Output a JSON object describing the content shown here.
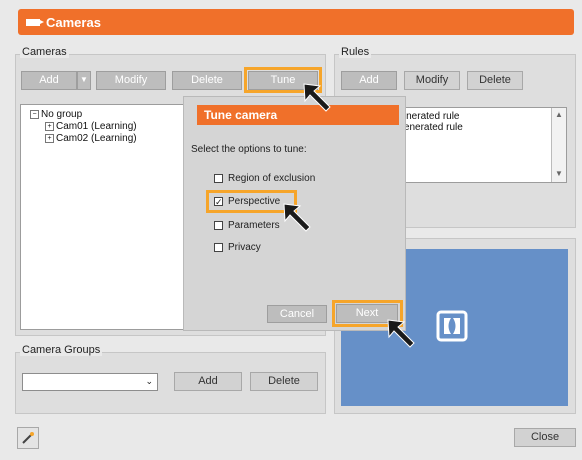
{
  "window": {
    "title": "Cameras"
  },
  "cameras": {
    "group_label": "Cameras",
    "add_label": "Add",
    "modify_label": "Modify",
    "delete_label": "Delete",
    "tune_label": "Tune",
    "tree": {
      "root": "No group",
      "items": [
        "Cam01 (Learning)",
        "Cam02 (Learning)"
      ]
    }
  },
  "rules": {
    "group_label": "Rules",
    "add_label": "Add",
    "modify_label": "Modify",
    "delete_label": "Delete",
    "items": [
      "generated rule",
      "-generated rule"
    ]
  },
  "camera_groups": {
    "group_label": "Camera Groups",
    "select_value": "",
    "add_label": "Add",
    "delete_label": "Delete"
  },
  "tune_dialog": {
    "title": "Tune camera",
    "instruction": "Select the options to tune:",
    "options": [
      {
        "label": "Region of exclusion",
        "checked": false
      },
      {
        "label": "Perspective",
        "checked": true
      },
      {
        "label": "Parameters",
        "checked": false
      },
      {
        "label": "Privacy",
        "checked": false
      }
    ],
    "cancel_label": "Cancel",
    "next_label": "Next"
  },
  "footer": {
    "close_label": "Close"
  },
  "colors": {
    "accent": "#f0702a",
    "highlight": "#f6a52a",
    "preview": "#6690c8"
  },
  "icons": {
    "window": "camera-icon",
    "tool": "wand-icon",
    "preview": "dolby-logo-icon",
    "pointer": "pointer-arrow-icon"
  }
}
